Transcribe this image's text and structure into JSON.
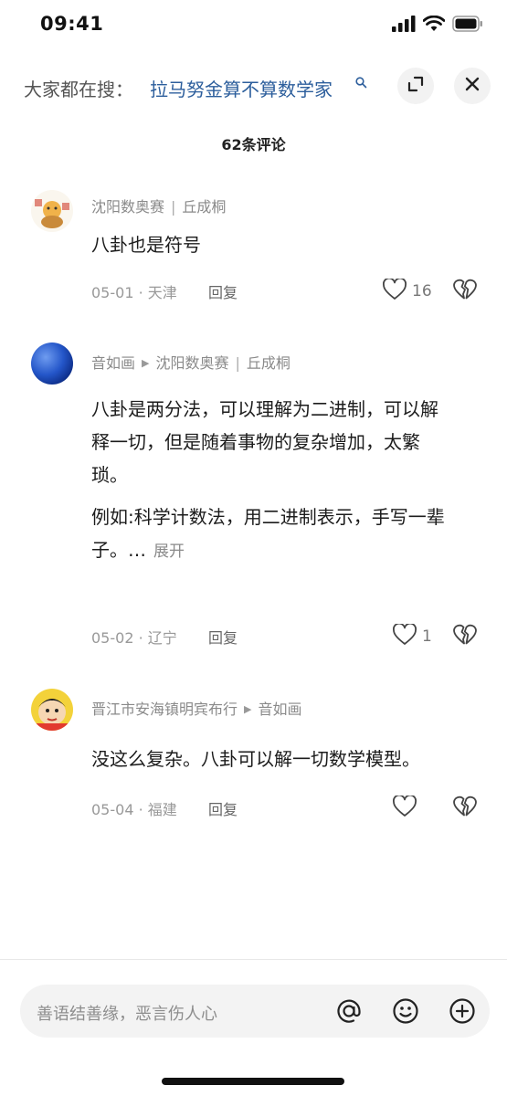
{
  "status_bar": {
    "time": "09:41"
  },
  "search": {
    "prefix": "大家都在搜：",
    "query": "拉马努金算不算数学家"
  },
  "header": {
    "comment_count": "62条评论"
  },
  "comments": [
    {
      "author": "沈阳数奥赛",
      "author_tag": "丘成桐",
      "text": "八卦也是符号",
      "date_location": "05-01 · 天津",
      "reply_label": "回复",
      "likes": "16"
    },
    {
      "author": "音如画",
      "reply_to": "沈阳数奥赛",
      "reply_to_tag": "丘成桐",
      "text_lines": [
        "八卦是两分法，可以理解为二进制，可以解",
        "释一切，但是随着事物的复杂增加，太繁",
        "琐。",
        "例如:科学计数法，用二进制表示，手写一辈",
        "子。…"
      ],
      "expand_label": "展开",
      "date_location": "05-02 · 辽宁",
      "reply_label": "回复",
      "likes": "1"
    },
    {
      "author": "晋江市安海镇明宾布行",
      "reply_to": "音如画",
      "text": "没这么复杂。八卦可以解一切数学模型。",
      "date_location": "05-04 · 福建",
      "reply_label": "回复",
      "likes": ""
    }
  ],
  "input": {
    "placeholder": "善语结善缘，恶言伤人心"
  },
  "icons": {
    "signal": "signal-icon",
    "wifi": "wifi-icon",
    "battery": "battery-icon",
    "search": "search-icon",
    "fullscreen": "fullscreen-icon",
    "close": "close-icon",
    "like": "heart-icon",
    "dislike": "broken-heart-icon",
    "mention": "at-icon",
    "emoji": "emoji-icon",
    "add": "plus-icon"
  },
  "colors": {
    "search_link": "#2c5e9c",
    "meta_text": "#999999",
    "body_text": "#1c1c1c"
  }
}
